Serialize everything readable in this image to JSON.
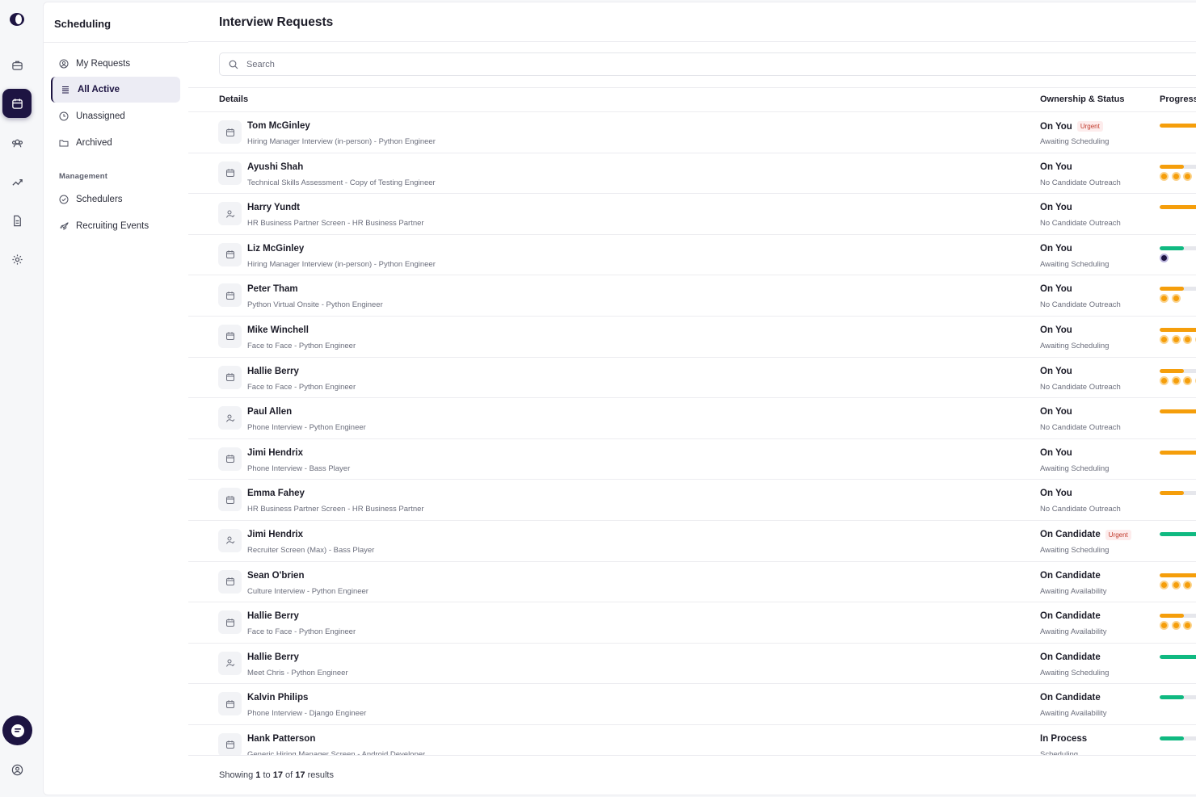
{
  "sidebar": {
    "title": "Scheduling",
    "items": [
      {
        "label": "My Requests",
        "icon": "user-circle-icon"
      },
      {
        "label": "All Active",
        "icon": "list-icon"
      },
      {
        "label": "Unassigned",
        "icon": "clock-icon"
      },
      {
        "label": "Archived",
        "icon": "folder-icon"
      }
    ],
    "section_label": "Management",
    "management_items": [
      {
        "label": "Schedulers",
        "icon": "check-circle-icon"
      },
      {
        "label": "Recruiting Events",
        "icon": "rocket-icon"
      }
    ]
  },
  "main": {
    "title": "Interview Requests",
    "search_placeholder": "Search",
    "columns": {
      "details": "Details",
      "ownership": "Ownership & Status",
      "progress": "Progress"
    }
  },
  "rows": [
    {
      "name": "Tom McGinley",
      "sub": "Hiring Manager Interview (in-person) - Python Engineer",
      "owner": "On You",
      "urgent": "Urgent",
      "status": "Awaiting Scheduling",
      "icon": "calendar-icon",
      "bar": 1.0,
      "bar_color": "orange",
      "dots": 0
    },
    {
      "name": "Ayushi Shah",
      "sub": "Technical Skills Assessment - Copy of Testing Engineer",
      "owner": "On You",
      "urgent": "",
      "status": "No Candidate Outreach",
      "icon": "calendar-icon",
      "bar": 0.5,
      "bar_color": "orange",
      "dots": 3
    },
    {
      "name": "Harry Yundt",
      "sub": "HR Business Partner Screen - HR Business Partner",
      "owner": "On You",
      "urgent": "",
      "status": "No Candidate Outreach",
      "icon": "user-check-icon",
      "bar": 1.0,
      "bar_color": "orange",
      "dots": 0
    },
    {
      "name": "Liz McGinley",
      "sub": "Hiring Manager Interview (in-person) - Python Engineer",
      "owner": "On You",
      "urgent": "",
      "status": "Awaiting Scheduling",
      "icon": "calendar-icon",
      "bar": 0.5,
      "bar_color": "green",
      "dots": 0,
      "purple_dot": true
    },
    {
      "name": "Peter Tham",
      "sub": "Python Virtual Onsite - Python Engineer",
      "owner": "On You",
      "urgent": "",
      "status": "No Candidate Outreach",
      "icon": "calendar-icon",
      "bar": 0.5,
      "bar_color": "orange",
      "dots": 2
    },
    {
      "name": "Mike Winchell",
      "sub": "Face to Face - Python Engineer",
      "owner": "On You",
      "urgent": "",
      "status": "Awaiting Scheduling",
      "icon": "calendar-icon",
      "bar": 1.0,
      "bar_color": "orange",
      "dots": 4
    },
    {
      "name": "Hallie Berry",
      "sub": "Face to Face - Python Engineer",
      "owner": "On You",
      "urgent": "",
      "status": "No Candidate Outreach",
      "icon": "calendar-icon",
      "bar": 0.5,
      "bar_color": "orange",
      "dots": 4
    },
    {
      "name": "Paul Allen",
      "sub": "Phone Interview - Python Engineer",
      "owner": "On You",
      "urgent": "",
      "status": "No Candidate Outreach",
      "icon": "user-check-icon",
      "bar": 1.0,
      "bar_color": "orange",
      "dots": 0
    },
    {
      "name": "Jimi Hendrix",
      "sub": "Phone Interview - Bass Player",
      "owner": "On You",
      "urgent": "",
      "status": "Awaiting Scheduling",
      "icon": "calendar-icon",
      "bar": 1.0,
      "bar_color": "orange",
      "dots": 0
    },
    {
      "name": "Emma Fahey",
      "sub": "HR Business Partner Screen - HR Business Partner",
      "owner": "On You",
      "urgent": "",
      "status": "No Candidate Outreach",
      "icon": "calendar-icon",
      "bar": 0.5,
      "bar_color": "orange",
      "dots": 0
    },
    {
      "name": "Jimi Hendrix",
      "sub": "Recruiter Screen (Max) - Bass Player",
      "owner": "On Candidate",
      "urgent": "Urgent",
      "status": "Awaiting Scheduling",
      "icon": "user-check-icon",
      "bar": 1.0,
      "bar_color": "green",
      "dots": 0
    },
    {
      "name": "Sean O'brien",
      "sub": "Culture Interview - Python Engineer",
      "owner": "On Candidate",
      "urgent": "",
      "status": "Awaiting Availability",
      "icon": "calendar-icon",
      "bar": 1.0,
      "bar_color": "orange",
      "dots": 3
    },
    {
      "name": "Hallie Berry",
      "sub": "Face to Face - Python Engineer",
      "owner": "On Candidate",
      "urgent": "",
      "status": "Awaiting Availability",
      "icon": "calendar-icon",
      "bar": 0.5,
      "bar_color": "orange",
      "dots": 3
    },
    {
      "name": "Hallie Berry",
      "sub": "Meet Chris - Python Engineer",
      "owner": "On Candidate",
      "urgent": "",
      "status": "Awaiting Scheduling",
      "icon": "user-check-icon",
      "bar": 1.0,
      "bar_color": "green",
      "dots": 0
    },
    {
      "name": "Kalvin Philips",
      "sub": "Phone Interview - Django Engineer",
      "owner": "On Candidate",
      "urgent": "",
      "status": "Awaiting Availability",
      "icon": "calendar-icon",
      "bar": 0.5,
      "bar_color": "green",
      "dots": 0
    },
    {
      "name": "Hank Patterson",
      "sub": "Generic Hiring Manager Screen - Android Developer",
      "owner": "In Process",
      "urgent": "",
      "status": "Scheduling",
      "icon": "calendar-icon",
      "bar": 0.5,
      "bar_color": "green",
      "dots": 0
    }
  ],
  "footer": {
    "prefix": "Showing",
    "from": "1",
    "to_word": "to",
    "to": "17",
    "of_word": "of",
    "total": "17",
    "suffix": "results"
  }
}
